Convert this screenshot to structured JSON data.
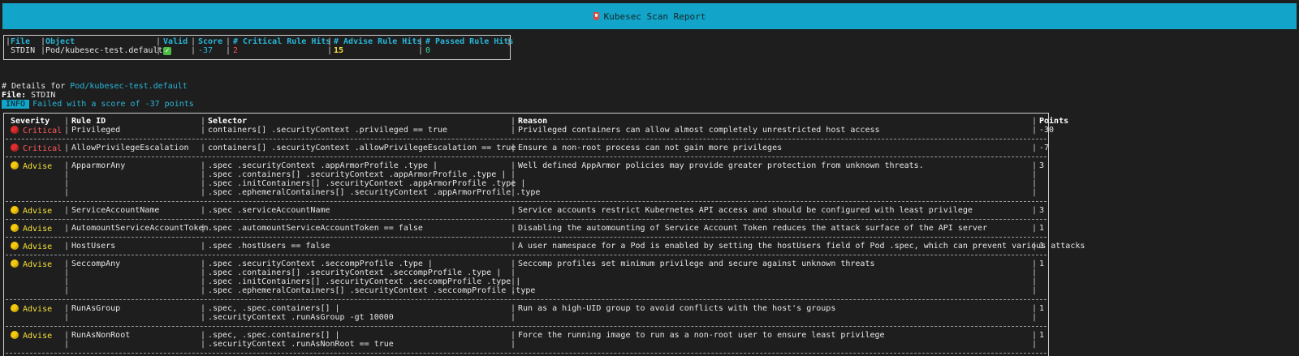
{
  "banner": {
    "title": "Kubesec Scan Report"
  },
  "summary": {
    "headers": [
      "File",
      "Object",
      "Valid",
      "Score",
      "# Critical Rule Hits",
      "# Advise Rule Hits",
      "# Passed Rule Hits"
    ],
    "file": "STDIN",
    "object": "Pod/kubesec-test.default",
    "valid": "✓",
    "score": "-37",
    "critical": "2",
    "advise": "15",
    "passed": "0"
  },
  "details": {
    "prefix": "# Details for ",
    "object": "Pod/kubesec-test.default",
    "file_label": "File:",
    "file_value": "STDIN",
    "info_badge": "INFO",
    "info_text": "Failed with a score of -37 points"
  },
  "table": {
    "headers": {
      "severity": "Severity",
      "rule_id": "Rule ID",
      "selector": "Selector",
      "reason": "Reason",
      "points": "Points"
    },
    "rows": [
      {
        "severity": "Critical",
        "level": "critical",
        "rule_id": "Privileged",
        "selector": [
          "containers[] .securityContext .privileged == true"
        ],
        "reason": "Privileged containers can allow almost completely unrestricted host access",
        "points": "-30"
      },
      {
        "severity": "Critical",
        "level": "critical",
        "rule_id": "AllowPrivilegeEscalation",
        "selector": [
          "containers[] .securityContext .allowPrivilegeEscalation == true"
        ],
        "reason": "Ensure a non-root process can not gain more privileges",
        "points": "-7"
      },
      {
        "severity": "Advise",
        "level": "advise",
        "rule_id": "ApparmorAny",
        "selector": [
          ".spec .securityContext .appArmorProfile .type |",
          ".spec .containers[] .securityContext .appArmorProfile .type |",
          ".spec .initContainers[] .securityContext .appArmorProfile .type |",
          ".spec .ephemeralContainers[] .securityContext .appArmorProfile .type"
        ],
        "reason": "Well defined AppArmor policies may provide greater protection from unknown threats.",
        "points": "3"
      },
      {
        "severity": "Advise",
        "level": "advise",
        "rule_id": "ServiceAccountName",
        "selector": [
          ".spec .serviceAccountName"
        ],
        "reason": "Service accounts restrict Kubernetes API access and should be configured with least privilege",
        "points": "3"
      },
      {
        "severity": "Advise",
        "level": "advise",
        "rule_id": "AutomountServiceAccountToken",
        "selector": [
          ".spec .automountServiceAccountToken == false"
        ],
        "reason": "Disabling the automounting of Service Account Token reduces the attack surface of the API server",
        "points": "1"
      },
      {
        "severity": "Advise",
        "level": "advise",
        "rule_id": "HostUsers",
        "selector": [
          ".spec .hostUsers == false"
        ],
        "reason": "A user namespace for a Pod is enabled by setting the hostUsers field of Pod .spec, which can prevent various attacks",
        "points": "1"
      },
      {
        "severity": "Advise",
        "level": "advise",
        "rule_id": "SeccompAny",
        "selector": [
          ".spec .securityContext .seccompProfile .type |",
          ".spec .containers[] .securityContext .seccompProfile .type |",
          ".spec .initContainers[] .securityContext .seccompProfile .type |",
          ".spec .ephemeralContainers[] .securityContext .seccompProfile .type"
        ],
        "reason": "Seccomp profiles set minimum privilege and secure against unknown threats",
        "points": "1"
      },
      {
        "severity": "Advise",
        "level": "advise",
        "rule_id": "RunAsGroup",
        "selector": [
          ".spec, .spec.containers[] |",
          ".securityContext .runAsGroup -gt 10000"
        ],
        "reason": "Run as a high-UID group to avoid conflicts with the host's groups",
        "points": "1"
      },
      {
        "severity": "Advise",
        "level": "advise",
        "rule_id": "RunAsNonRoot",
        "selector": [
          ".spec, .spec.containers[] |",
          ".securityContext .runAsNonRoot == true"
        ],
        "reason": "Force the running image to run as a non-root user to ensure least privilege",
        "points": "1"
      }
    ]
  },
  "colors": {
    "banner": "#12a5c9",
    "background": "#1e1e1e",
    "critical": "#ff5a5a",
    "advise": "#f5e03a",
    "accent": "#29b6d9"
  }
}
